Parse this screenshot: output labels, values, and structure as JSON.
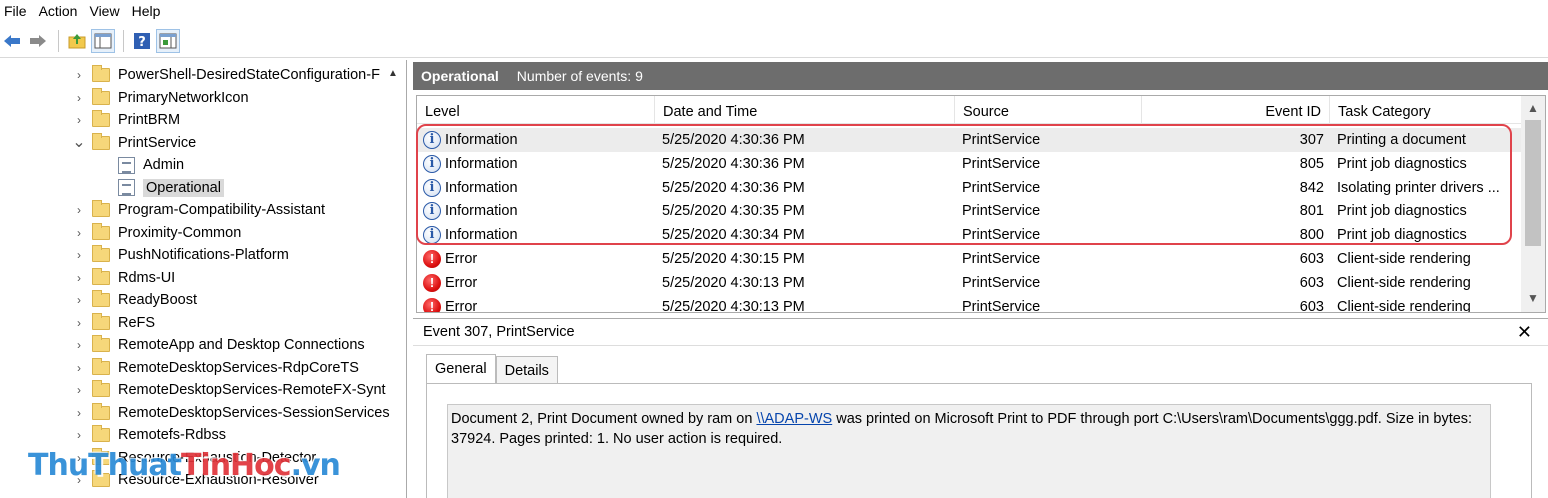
{
  "menu": [
    "File",
    "Action",
    "View",
    "Help"
  ],
  "toolbar": {
    "icons": [
      "back-arrow-icon",
      "forward-arrow-icon",
      "up-folder-icon",
      "show-hide-tree-icon",
      "help-icon",
      "properties-icon"
    ]
  },
  "tree": {
    "items": [
      {
        "label": "PowerShell-DesiredStateConfiguration-F",
        "type": "folder",
        "expanded": false
      },
      {
        "label": "PrimaryNetworkIcon",
        "type": "folder",
        "expanded": false
      },
      {
        "label": "PrintBRM",
        "type": "folder",
        "expanded": false
      },
      {
        "label": "PrintService",
        "type": "folder",
        "expanded": true
      },
      {
        "label": "Admin",
        "type": "log",
        "child": true
      },
      {
        "label": "Operational",
        "type": "log",
        "child": true,
        "selected": true
      },
      {
        "label": "Program-Compatibility-Assistant",
        "type": "folder",
        "expanded": false
      },
      {
        "label": "Proximity-Common",
        "type": "folder",
        "expanded": false
      },
      {
        "label": "PushNotifications-Platform",
        "type": "folder",
        "expanded": false
      },
      {
        "label": "Rdms-UI",
        "type": "folder",
        "expanded": false
      },
      {
        "label": "ReadyBoost",
        "type": "folder",
        "expanded": false
      },
      {
        "label": "ReFS",
        "type": "folder",
        "expanded": false
      },
      {
        "label": "RemoteApp and Desktop Connections",
        "type": "folder",
        "expanded": false
      },
      {
        "label": "RemoteDesktopServices-RdpCoreTS",
        "type": "folder",
        "expanded": false
      },
      {
        "label": "RemoteDesktopServices-RemoteFX-Synt",
        "type": "folder",
        "expanded": false
      },
      {
        "label": "RemoteDesktopServices-SessionServices",
        "type": "folder",
        "expanded": false
      },
      {
        "label": "Remotefs-Rdbss",
        "type": "folder",
        "expanded": false
      },
      {
        "label": "Resource-Exhaustion-Detector",
        "type": "folder",
        "expanded": false
      },
      {
        "label": "Resource-Exhaustion-Resolver",
        "type": "folder",
        "expanded": false
      }
    ]
  },
  "events_header": {
    "title": "Operational",
    "count_label": "Number of events: 9"
  },
  "table": {
    "columns": [
      "Level",
      "Date and Time",
      "Source",
      "Event ID",
      "Task Category"
    ],
    "rows": [
      {
        "level": "Information",
        "kind": "info",
        "date": "5/25/2020 4:30:36 PM",
        "source": "PrintService",
        "id": "307",
        "category": "Printing a document"
      },
      {
        "level": "Information",
        "kind": "info",
        "date": "5/25/2020 4:30:36 PM",
        "source": "PrintService",
        "id": "805",
        "category": "Print job diagnostics"
      },
      {
        "level": "Information",
        "kind": "info",
        "date": "5/25/2020 4:30:36 PM",
        "source": "PrintService",
        "id": "842",
        "category": "Isolating printer drivers ..."
      },
      {
        "level": "Information",
        "kind": "info",
        "date": "5/25/2020 4:30:35 PM",
        "source": "PrintService",
        "id": "801",
        "category": "Print job diagnostics"
      },
      {
        "level": "Information",
        "kind": "info",
        "date": "5/25/2020 4:30:34 PM",
        "source": "PrintService",
        "id": "800",
        "category": "Print job diagnostics"
      },
      {
        "level": "Error",
        "kind": "error",
        "date": "5/25/2020 4:30:15 PM",
        "source": "PrintService",
        "id": "603",
        "category": "Client-side rendering"
      },
      {
        "level": "Error",
        "kind": "error",
        "date": "5/25/2020 4:30:13 PM",
        "source": "PrintService",
        "id": "603",
        "category": "Client-side rendering"
      },
      {
        "level": "Error",
        "kind": "error",
        "date": "5/25/2020 4:30:13 PM",
        "source": "PrintService",
        "id": "603",
        "category": "Client-side rendering"
      }
    ]
  },
  "detail": {
    "title": "Event 307, PrintService",
    "tabs": [
      "General",
      "Details"
    ],
    "desc_before": "Document 2, Print Document owned by ram on ",
    "desc_link": "\\\\ADAP-WS",
    "desc_after": " was printed on Microsoft Print to PDF through port C:\\Users\\ram\\Documents\\ggg.pdf.  Size in bytes: 37924. Pages printed: 1. No user action is required."
  },
  "watermark": {
    "part1": "ThuThuat",
    "part2": "TinHoc",
    "part3": ".vn"
  },
  "colors": {
    "highlight": "#e0434b",
    "header_bar": "#6d6d6d",
    "link": "#0645ad",
    "watermark_blue": "#2a8ad6",
    "watermark_red": "#e0343a"
  }
}
